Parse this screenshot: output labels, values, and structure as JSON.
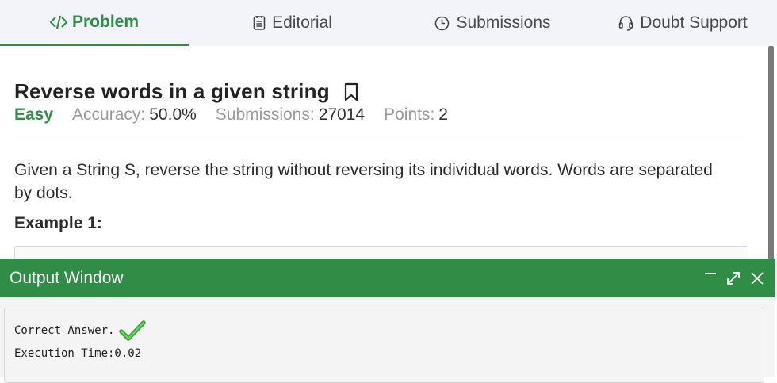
{
  "tabs": [
    {
      "label": "Problem",
      "icon": "code-icon"
    },
    {
      "label": "Editorial",
      "icon": "document-icon"
    },
    {
      "label": "Submissions",
      "icon": "clock-icon"
    },
    {
      "label": "Doubt Support",
      "icon": "headset-icon"
    }
  ],
  "active_tab": "Problem",
  "problem": {
    "title": "Reverse words in a given string",
    "difficulty": "Easy",
    "accuracy_label": "Accuracy:",
    "accuracy_value": "50.0%",
    "submissions_label": "Submissions:",
    "submissions_value": "27014",
    "points_label": "Points:",
    "points_value": "2",
    "description": "Given a String S, reverse the string without reversing its individual words. Words are separated by dots.",
    "example_heading": "Example 1:"
  },
  "output": {
    "title": "Output Window",
    "result": "Correct Answer.",
    "execution_time": "Execution Time:0.02"
  },
  "colors": {
    "accent": "#2f8d46",
    "tabbar_bg": "#f2f4fa"
  }
}
